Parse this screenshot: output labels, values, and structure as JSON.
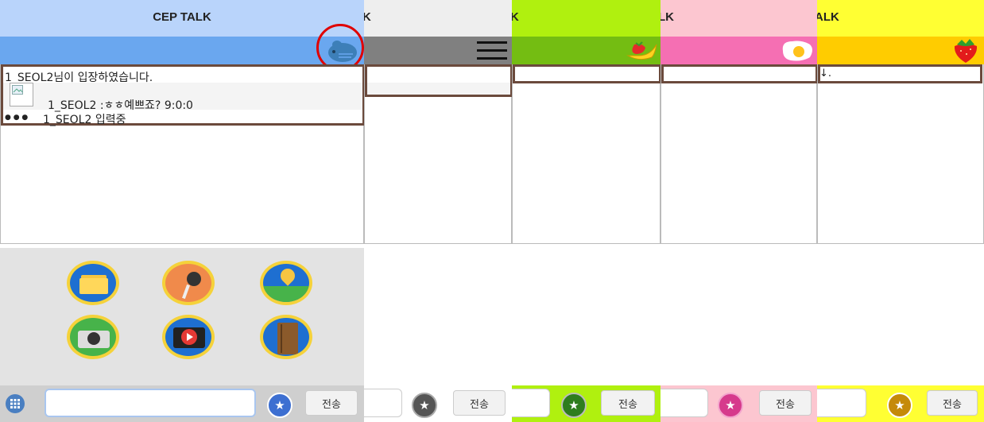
{
  "panel1": {
    "title": "CEP TALK",
    "messages": {
      "enter": "1_SEOL2님이 입장하였습니다.",
      "chat": "1_SEOL2 :ㅎㅎ예쁘죠? 9:0:0",
      "typing": "1_SEOL2 입력중",
      "typing_dots": "● ● ●"
    },
    "send_label": "전송",
    "input_value": "",
    "menu_icons": [
      "folder-icon",
      "microphone-icon",
      "location-pin-icon",
      "camera-icon",
      "video-play-icon",
      "book-icon"
    ]
  },
  "panel2": {
    "title": "K",
    "send_label": "전송",
    "theme_icon": "hamburger-menu-icon"
  },
  "panel3": {
    "title": "K",
    "send_label": "전송",
    "theme_icon": "fruit-strawberry-banana-icon"
  },
  "panel4": {
    "title": "LK",
    "send_label": "전송",
    "theme_icon": "fried-egg-icon"
  },
  "panel5": {
    "title": "ALK",
    "send_label": "전송",
    "partial_text": "↓.",
    "theme_icon": "strawberry-icon"
  },
  "colors": {
    "panel1_title": "#b9d4fb",
    "panel1_sub": "#6aa7ef",
    "panel2_title": "#eeeeee",
    "panel2_sub": "#808080",
    "panel3_title": "#b0f00f",
    "panel3_sub": "#74bd12",
    "panel4_title": "#fcc6d0",
    "panel4_sub": "#f56fb3",
    "panel5_title": "#ffff33",
    "panel5_sub": "#ffcc00",
    "highlight_circle": "#e00000"
  }
}
